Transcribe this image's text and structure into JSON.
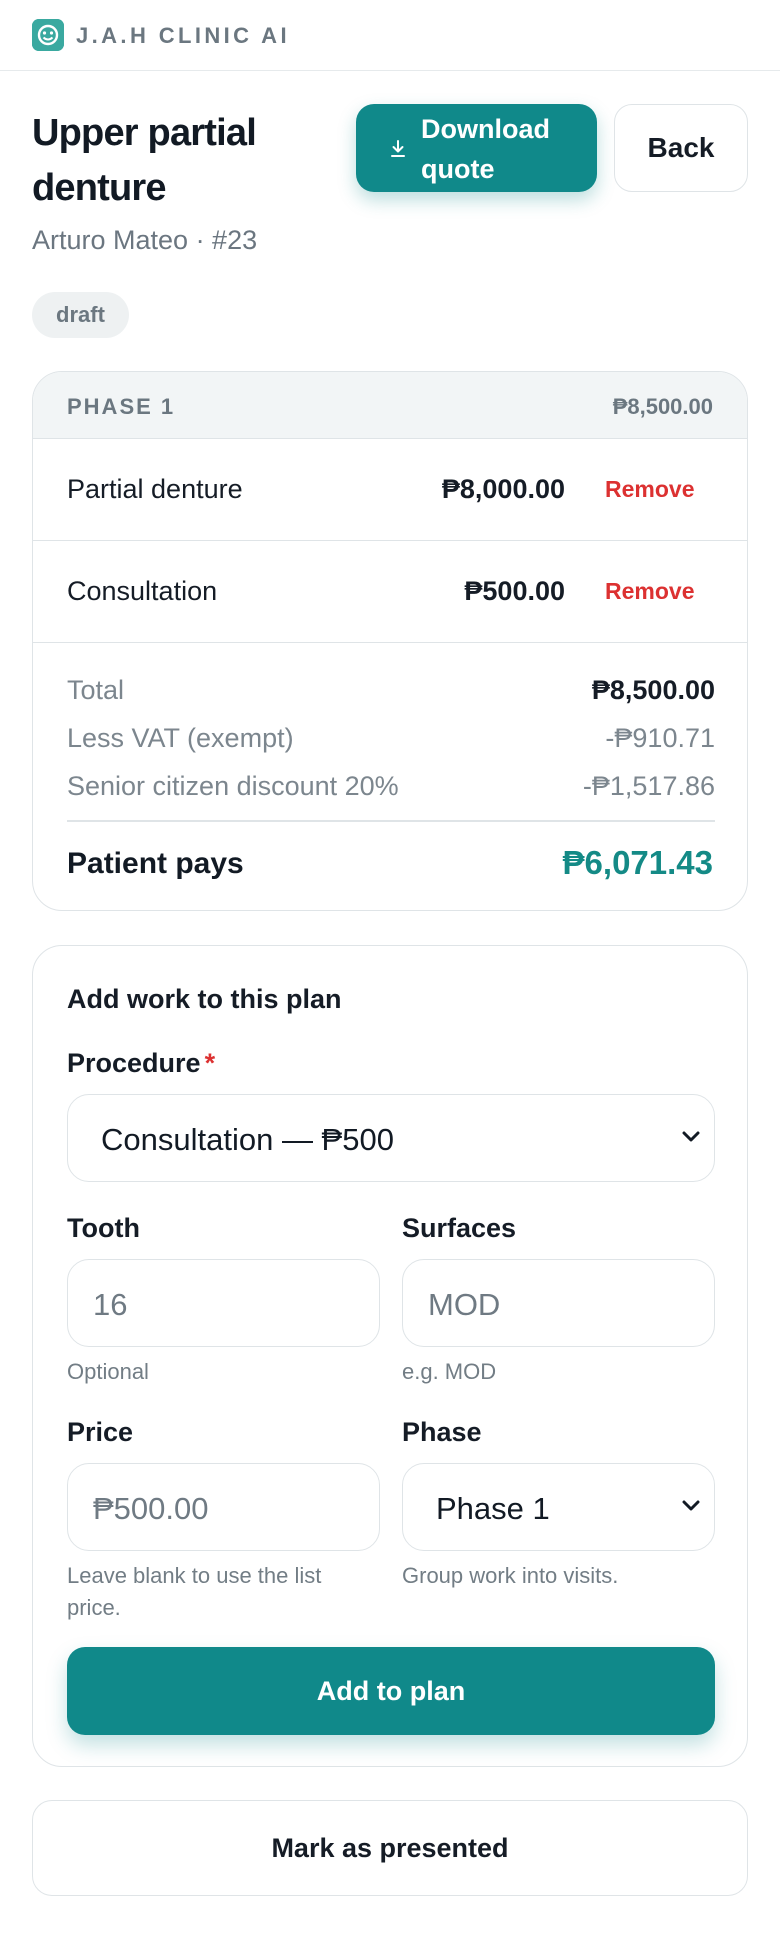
{
  "brand": {
    "name": "J.A.H CLINIC AI",
    "icon": "tooth-logo-icon",
    "color": "#3aa9a0"
  },
  "header": {
    "title": "Upper partial denture",
    "subtitle": "Arturo Mateo · #23",
    "download_label": "Download quote",
    "download_icon": "download-icon",
    "back_label": "Back",
    "status_badge": "draft"
  },
  "phase": {
    "name": "PHASE 1",
    "total": "₱8,500.00",
    "items": [
      {
        "name": "Partial denture",
        "price": "₱8,000.00",
        "remove_label": "Remove"
      },
      {
        "name": "Consultation",
        "price": "₱500.00",
        "remove_label": "Remove"
      }
    ],
    "summary": {
      "total_label": "Total",
      "total_value": "₱8,500.00",
      "vat_label": "Less VAT (exempt)",
      "vat_value": "-₱910.71",
      "discount_label": "Senior citizen discount 20%",
      "discount_value": "-₱1,517.86",
      "pays_label": "Patient pays",
      "pays_value": "₱6,071.43"
    }
  },
  "add_form": {
    "title": "Add work to this plan",
    "procedure_label": "Procedure",
    "procedure_required": "*",
    "procedure_value": "Consultation — ₱500",
    "tooth_label": "Tooth",
    "tooth_placeholder": "16",
    "tooth_hint": "Optional",
    "surfaces_label": "Surfaces",
    "surfaces_placeholder": "MOD",
    "surfaces_hint": "e.g. MOD",
    "price_label": "Price",
    "price_placeholder": "₱500.00",
    "price_hint": "Leave blank to use the list price.",
    "phase_label": "Phase",
    "phase_value": "Phase 1",
    "phase_hint": "Group work into visits.",
    "submit_label": "Add to plan"
  },
  "footer": {
    "mark_presented_label": "Mark as presented"
  },
  "colors": {
    "accent": "#10898a",
    "danger": "#dc3131",
    "pays": "#148a86"
  }
}
